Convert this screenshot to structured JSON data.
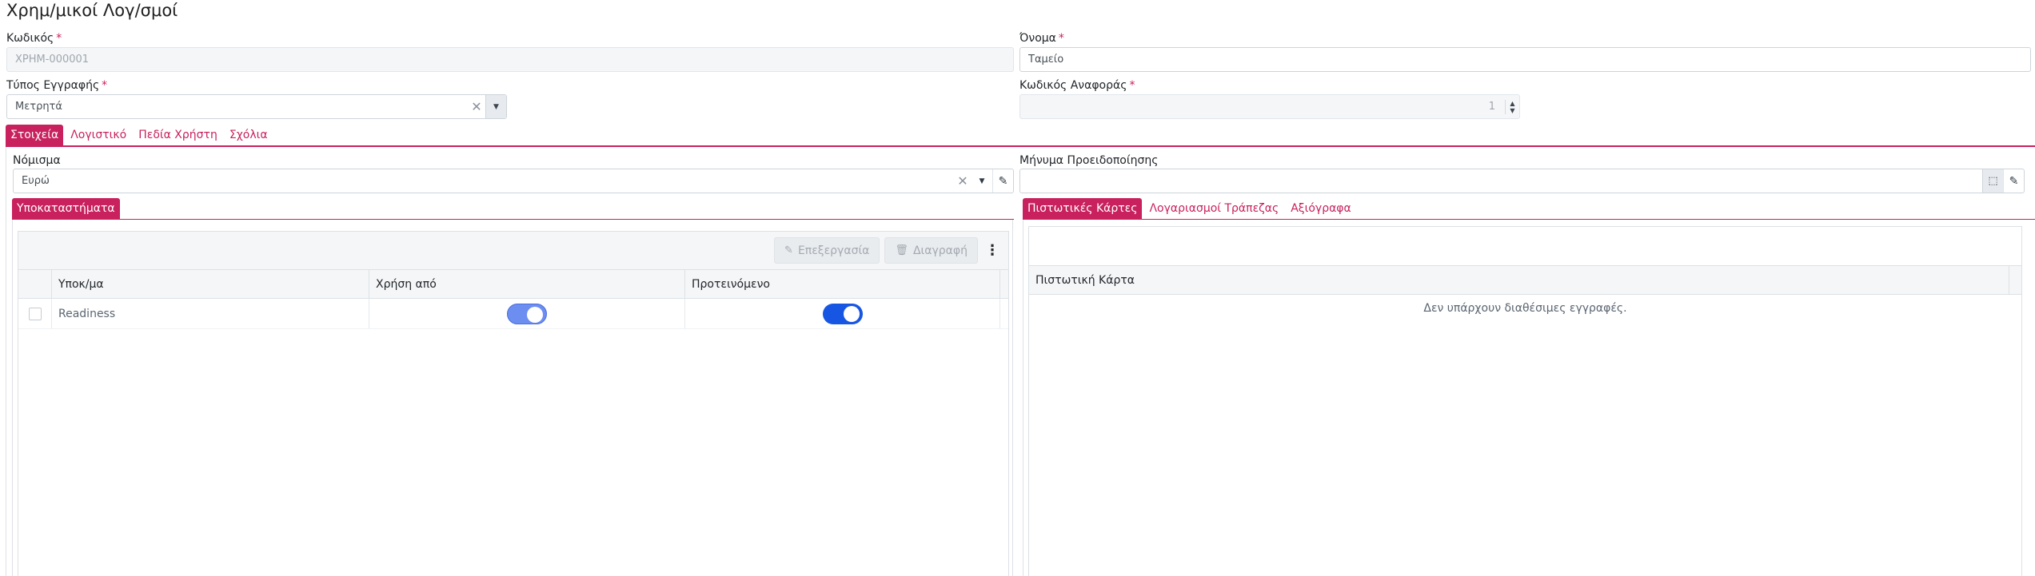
{
  "page": {
    "title": "Χρημ/μικοί Λογ/σμοί"
  },
  "form": {
    "code": {
      "label": "Κωδικός",
      "value": "ΧΡΗΜ-000001"
    },
    "name": {
      "label": "Όνομα",
      "value": "Ταμείο"
    },
    "entry_type": {
      "label": "Τύπος Εγγραφής",
      "value": "Μετρητά"
    },
    "reference_code": {
      "label": "Κωδικός Αναφοράς",
      "value": "1"
    },
    "required_mark": "*"
  },
  "main_tabs": [
    {
      "label": "Στοιχεία",
      "active": true
    },
    {
      "label": "Λογιστικό",
      "active": false
    },
    {
      "label": "Πεδία Χρήστη",
      "active": false
    },
    {
      "label": "Σχόλια",
      "active": false
    }
  ],
  "details": {
    "currency": {
      "label": "Νόμισμα",
      "value": "Ευρώ"
    },
    "warning_message": {
      "label": "Μήνυμα Προειδοποίησης",
      "value": ""
    }
  },
  "branches": {
    "tab_label": "Υποκαταστήματα",
    "toolbar": {
      "edit_label": "Επεξεργασία",
      "delete_label": "Διαγραφή"
    },
    "columns": [
      "Υποκ/μα",
      "Χρήση από",
      "Προτεινόμενο"
    ],
    "rows": [
      {
        "branch": "Readiness",
        "use_from": true,
        "suggested": true
      }
    ]
  },
  "right_tabs": [
    {
      "label": "Πιστωτικές Κάρτες",
      "active": true
    },
    {
      "label": "Λογαριασμοί Τράπεζας",
      "active": false
    },
    {
      "label": "Αξιόγραφα",
      "active": false
    }
  ],
  "credit_cards": {
    "column": "Πιστωτική Κάρτα",
    "empty_message": "Δεν υπάρχουν διαθέσιμες εγγραφές."
  },
  "colors": {
    "accent": "#c8215d",
    "toggle_light": "#6c8ef0",
    "toggle_strong": "#1756e3"
  },
  "icons": [
    "clear-icon",
    "chevron-down-icon",
    "pencil-icon",
    "trash-icon",
    "kebab-menu-icon",
    "spin-up-icon",
    "spin-down-icon",
    "expand-icon"
  ]
}
